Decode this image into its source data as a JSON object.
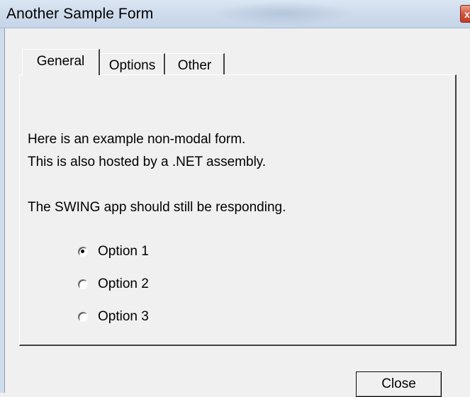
{
  "window": {
    "title": "Another Sample Form"
  },
  "tabs": [
    {
      "label": "General",
      "selected": true
    },
    {
      "label": "Options",
      "selected": false
    },
    {
      "label": "Other",
      "selected": false
    }
  ],
  "panel": {
    "lines": [
      "Here is an example non-modal form.",
      "This is also hosted by a .NET assembly.",
      "The SWING app should still be responding."
    ],
    "options": [
      {
        "label": "Option 1",
        "checked": true
      },
      {
        "label": "Option 2",
        "checked": false
      },
      {
        "label": "Option 3",
        "checked": false
      }
    ]
  },
  "buttons": {
    "close_label": "Close"
  }
}
